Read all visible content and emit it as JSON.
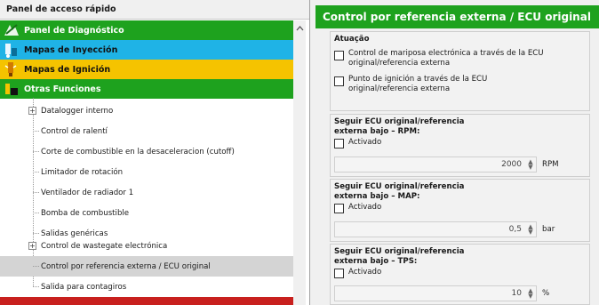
{
  "left_panel": {
    "title": "Panel de acceso rápido",
    "categories": [
      {
        "label": "Panel de Diagnóstico",
        "icon": "diagnostic-icon",
        "color": "#1ea21e"
      },
      {
        "label": "Mapas de Inyección",
        "icon": "injection-icon",
        "color": "#1fb3e6"
      },
      {
        "label": "Mapas de Ignición",
        "icon": "ignition-icon",
        "color": "#f5c300"
      },
      {
        "label": "Otras Funciones",
        "icon": "functions-icon",
        "color": "#1ea21e"
      }
    ],
    "tree_items": [
      {
        "label": "Datalogger interno",
        "expandable": true
      },
      {
        "label": "Control de ralentí",
        "expandable": false
      },
      {
        "label": "Corte de combustible en la desaceleracion (cutoff)",
        "expandable": false
      },
      {
        "label": "Limitador de rotación",
        "expandable": false
      },
      {
        "label": "Ventilador de radiador 1",
        "expandable": false
      },
      {
        "label": "Bomba de combustible",
        "expandable": false
      },
      {
        "label": "Salidas genéricas",
        "expandable": false
      },
      {
        "label": "Control de wastegate electrónica",
        "expandable": true
      },
      {
        "label": "Control por referencia externa / ECU original",
        "expandable": false,
        "selected": true
      },
      {
        "label": "Salida para contagiros",
        "expandable": false
      }
    ],
    "expander_symbol": "+"
  },
  "right_panel": {
    "header": "Control por referencia externa / ECU original",
    "actuation": {
      "title": "Atuação",
      "options": [
        "Control de mariposa electrónica a través de la ECU original/referencia externa",
        "Punto de ignición a través de la ECU original/referencia externa"
      ]
    },
    "follow_groups": [
      {
        "title": "Seguir ECU original/referencia externa bajo – RPM:",
        "checkbox_label": "Activado",
        "value": "2000",
        "unit": "RPM"
      },
      {
        "title": "Seguir ECU original/referencia externa bajo – MAP:",
        "checkbox_label": "Activado",
        "value": "0,5",
        "unit": "bar"
      },
      {
        "title": "Seguir ECU original/referencia externa bajo – TPS:",
        "checkbox_label": "Activado",
        "value": "10",
        "unit": "%"
      }
    ]
  }
}
